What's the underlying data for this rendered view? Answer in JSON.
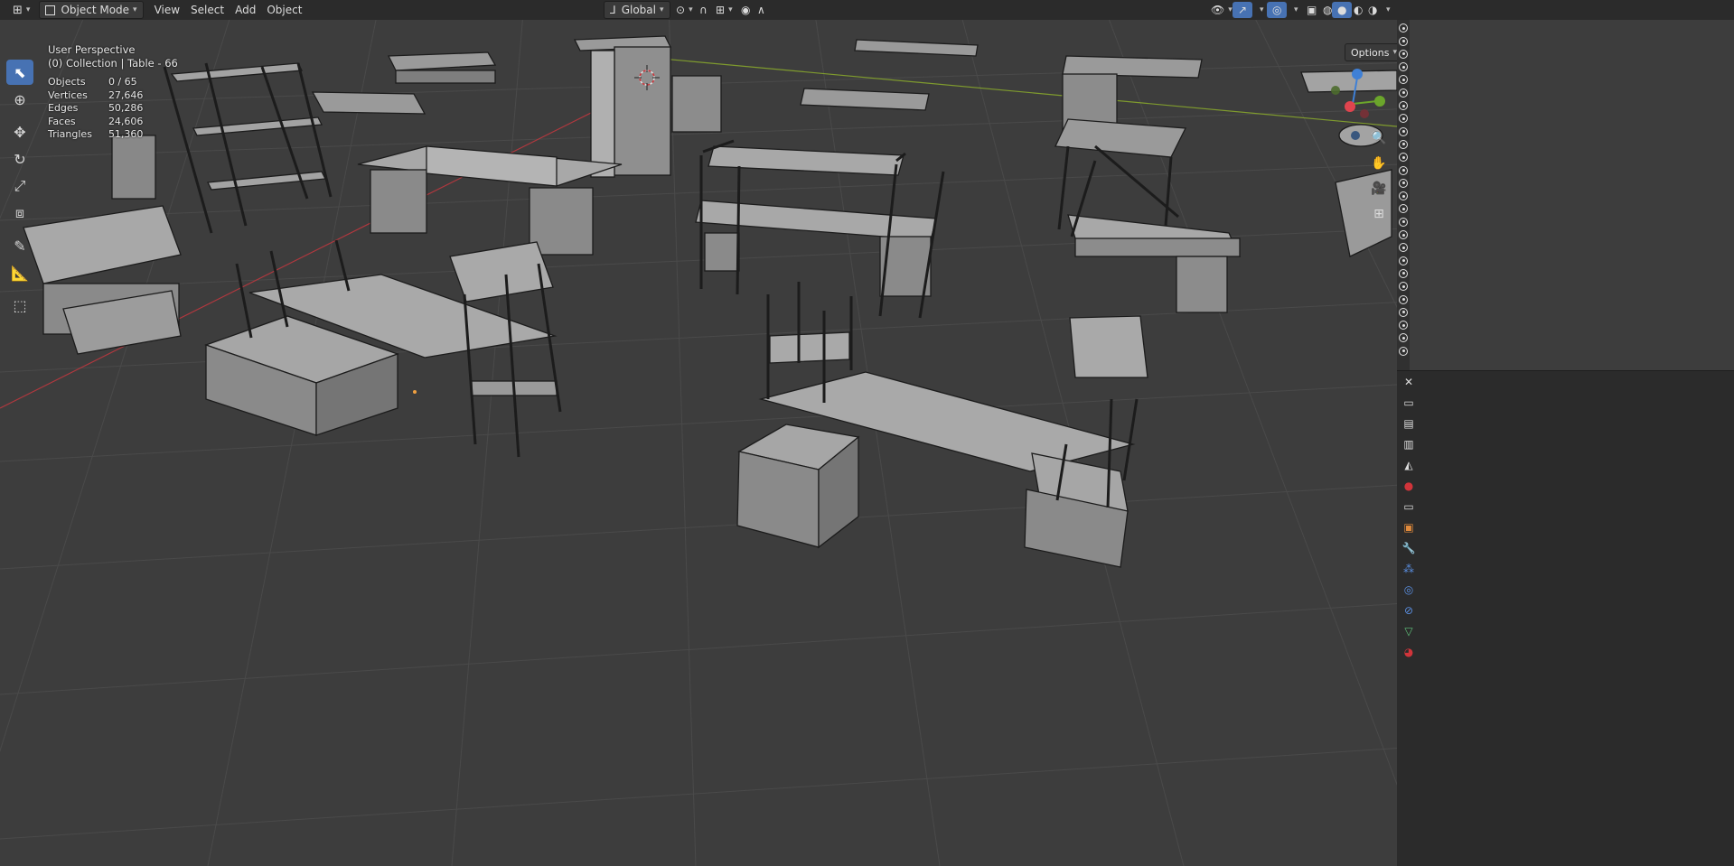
{
  "header": {
    "editor_type_icon": "3d-viewport-icon",
    "mode": "Object Mode",
    "menus": [
      "View",
      "Select",
      "Add",
      "Object"
    ],
    "transform_orientation": "Global",
    "options_label": "Options"
  },
  "overlay": {
    "perspective": "User Perspective",
    "collection": "(0) Collection | Table - 66",
    "stats": [
      {
        "label": "Objects",
        "value": "0 / 65"
      },
      {
        "label": "Vertices",
        "value": "27,646"
      },
      {
        "label": "Edges",
        "value": "50,286"
      },
      {
        "label": "Faces",
        "value": "24,606"
      },
      {
        "label": "Triangles",
        "value": "51,360"
      }
    ]
  },
  "tools": [
    "select-box-icon",
    "cursor-icon",
    "move-icon",
    "rotate-icon",
    "scale-icon",
    "transform-icon",
    "annotate-icon",
    "measure-icon",
    "add-cube-icon"
  ],
  "nav_buttons": [
    "zoom-icon",
    "pan-hand-icon",
    "camera-icon",
    "grid-ortho-icon"
  ],
  "gizmo": {
    "x_color": "#e0444e",
    "y_color": "#6ba52b",
    "z_color": "#3f80d6"
  },
  "colors": {
    "accent": "#4772b3",
    "viewport_bg": "#3d3d3d",
    "header_bg": "#2b2b2b",
    "x_axis": "#b3383e",
    "y_axis": "#7f9b2e"
  },
  "property_tabs": [
    "tool-icon",
    "render-icon",
    "output-icon",
    "view-layer-icon",
    "scene-icon",
    "world-icon",
    "collection-icon",
    "object-icon",
    "modifier-icon",
    "particles-icon",
    "physics-icon",
    "constraints-icon",
    "data-icon",
    "material-icon"
  ]
}
